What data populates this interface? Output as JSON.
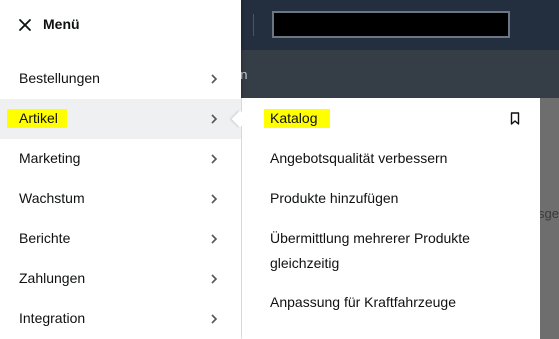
{
  "menu": {
    "title": "Menü",
    "items": [
      {
        "label": "Bestellungen"
      },
      {
        "label": "Artikel"
      },
      {
        "label": "Marketing"
      },
      {
        "label": "Wachstum"
      },
      {
        "label": "Berichte"
      },
      {
        "label": "Zahlungen"
      },
      {
        "label": "Integration"
      }
    ]
  },
  "submenu": {
    "items": [
      {
        "label": "Katalog"
      },
      {
        "label": "Angebotsqualität verbessern"
      },
      {
        "label": "Produkte hinzufügen"
      },
      {
        "label": "Übermittlung mehrerer Produkte gleichzeitig"
      },
      {
        "label": "Anpassung für Kraftfahrzeuge"
      }
    ]
  },
  "background": {
    "clipped_tab": "en",
    "clipped_text": "sge"
  },
  "colors": {
    "highlight": "#ffff00",
    "topbar": "#232f3e",
    "subbar": "#353d47"
  }
}
